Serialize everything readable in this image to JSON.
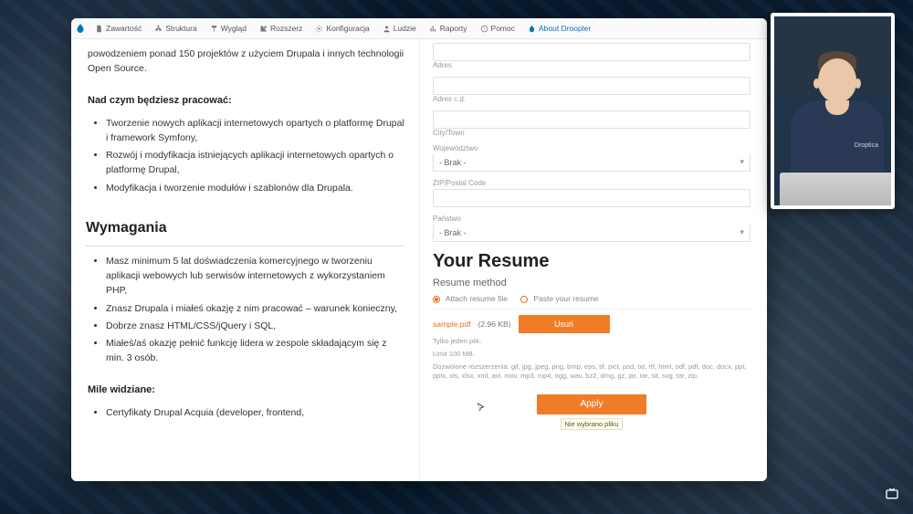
{
  "adminbar": {
    "items": [
      {
        "icon": "file-icon",
        "label": "Zawartość"
      },
      {
        "icon": "hierarchy-icon",
        "label": "Struktura"
      },
      {
        "icon": "paint-icon",
        "label": "Wygląd"
      },
      {
        "icon": "puzzle-icon",
        "label": "Rozszerz"
      },
      {
        "icon": "gear-icon",
        "label": "Konfiguracja"
      },
      {
        "icon": "person-icon",
        "label": "Ludzie"
      },
      {
        "icon": "reports-icon",
        "label": "Raporty"
      },
      {
        "icon": "help-icon",
        "label": "Pomoc"
      },
      {
        "icon": "droopler-icon",
        "label": "About Droopler"
      }
    ]
  },
  "intro": "powodzeniem ponad 150 projektów z użyciem Drupala i innych technologii Open Source.",
  "work_heading": "Nad czym będziesz pracować:",
  "work_items": [
    "Tworzenie nowych aplikacji internetowych opartych o platformę Drupal i framework Symfony,",
    "Rozwój i modyfikacja istniejących aplikacji internetowych opartych o platformę Drupal,",
    "Modyfikacja i tworzenie modułów i szablonów dla Drupala."
  ],
  "req_heading": "Wymagania",
  "req_items": [
    "Masz minimum 5 lat doświadczenia komercyjnego w tworzeniu aplikacji webowych lub serwisów internetowych z wykorzystaniem PHP,",
    "Znasz Drupala i miałeś okazję z nim pracować – warunek konieczny,",
    "Dobrze znasz HTML/CSS/jQuery i SQL,",
    "Miałeś/aś okazję pełnić funkcję lidera w zespole składającym się z min. 3 osób."
  ],
  "nice_heading": "Mile widziane:",
  "nice_items": [
    "Certyfikaty Drupal Acquia (developer, frontend,"
  ],
  "form": {
    "adres": "Adres",
    "adres_cd": "Adres c.d.",
    "city": "City/Town",
    "woj": "Województwo",
    "woj_value": "- Brak -",
    "zip": "ZIP/Postal Code",
    "country": "Państwo",
    "country_value": "- Brak -"
  },
  "resume": {
    "title": "Your Resume",
    "method": "Resume method",
    "opt_attach": "Attach resume file",
    "opt_paste": "Paste your resume",
    "file_name": "sample.pdf",
    "file_size": "(2.96 KB)",
    "delete": "Usuń",
    "meta1": "Tylko jeden plik.",
    "meta2": "Limit 100 MB.",
    "meta3": "Dozwolone rozszerzenia: gif, jpg, jpeg, png, bmp, eps, tif, pict, psd, txt, rtf, html, odf, pdf, doc, docx, ppt, pptx, xls, xlsx, xml, avi, mov, mp3, mp4, ogg, wav, bz2, dmg, gz, jar, rar, sit, svg, tar, zip.",
    "apply": "Apply",
    "status_tip": "Nie wybrano pliku"
  },
  "webcam": {
    "logo": "Droptica"
  }
}
